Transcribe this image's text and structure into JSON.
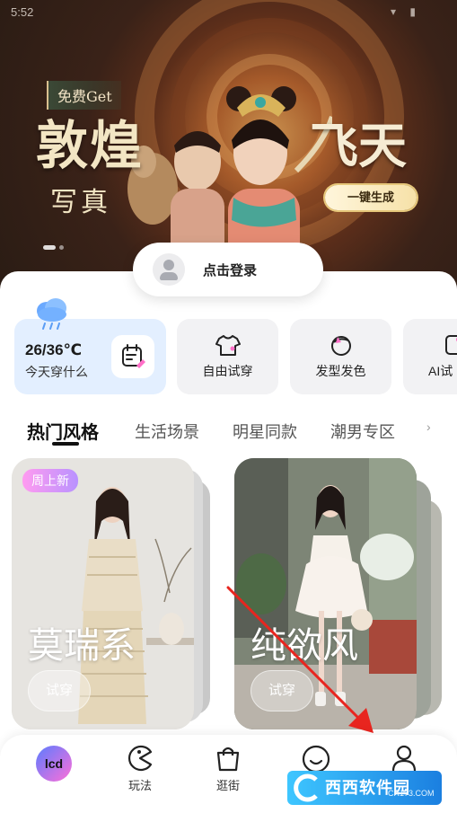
{
  "status_bar": {
    "time": "5:52"
  },
  "banner": {
    "free_tag": "免费Get",
    "title_main": "敦煌",
    "title_sub": "写真",
    "title_right": "飞天",
    "generate_button": "一键生成"
  },
  "login": {
    "label": "点击登录"
  },
  "features": {
    "weather": {
      "temperature": "26/36℃",
      "label": "今天穿什么"
    },
    "items": [
      {
        "label": "自由试穿",
        "icon": "tshirt-icon"
      },
      {
        "label": "发型发色",
        "icon": "hair-icon"
      },
      {
        "label": "AI试",
        "icon": "ai-try-icon"
      }
    ]
  },
  "tabs": [
    "热门风格",
    "生活场景",
    "明星同款",
    "潮男专区"
  ],
  "cards": [
    {
      "name": "莫瑞系",
      "badge": "周上新",
      "button": "试穿"
    },
    {
      "name": "纯欲风",
      "button": "试穿"
    }
  ],
  "nav": {
    "items": [
      {
        "label": "",
        "icon": "home-logo-icon"
      },
      {
        "label": "玩法",
        "icon": "pacman-icon"
      },
      {
        "label": "逛街",
        "icon": "shopping-bag-icon"
      },
      {
        "label": "",
        "icon": "smile-icon"
      },
      {
        "label": "",
        "icon": "profile-icon"
      }
    ]
  },
  "watermark": {
    "text": "西西软件园",
    "sub": "CR173.COM"
  },
  "colors": {
    "accent": "#111111",
    "weather_bg": "#e3efff",
    "badge": "#c79bff",
    "arrow": "#e8251f"
  }
}
